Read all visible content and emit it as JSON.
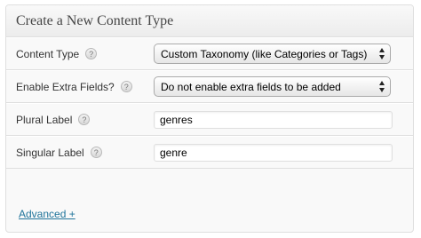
{
  "panel": {
    "title": "Create a New Content Type"
  },
  "rows": [
    {
      "label": "Content Type",
      "type": "select",
      "value": "Custom Taxonomy (like Categories or Tags)"
    },
    {
      "label": "Enable Extra Fields?",
      "type": "select",
      "value": "Do not enable extra fields to be added"
    },
    {
      "label": "Plural Label",
      "type": "text",
      "value": "genres"
    },
    {
      "label": "Singular Label",
      "type": "text",
      "value": "genre"
    }
  ],
  "help_glyph": "?",
  "advanced_link": "Advanced +",
  "colors": {
    "link": "#21759b",
    "panel_bg": "#f9f9f9",
    "border": "#dfdfdf"
  },
  "icons": {
    "help": "question-mark-circle-icon",
    "select_arrows": "up-down-chevron-icon"
  }
}
